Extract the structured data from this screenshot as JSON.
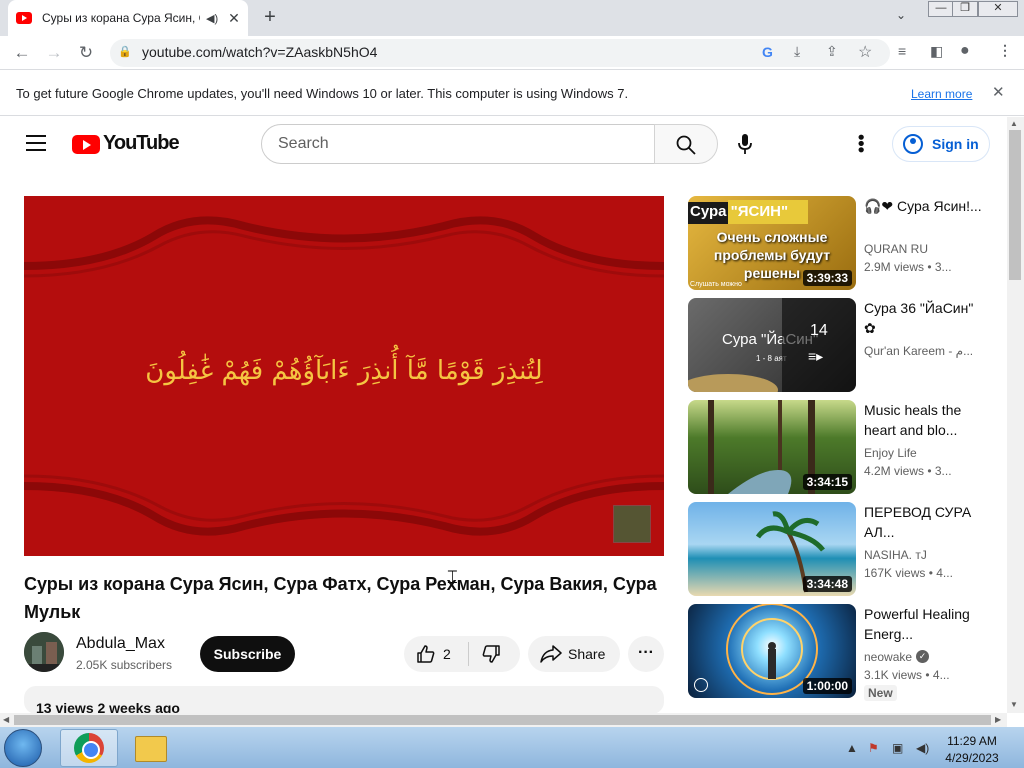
{
  "browser": {
    "tab_title": "Суры из корана Сура Ясин, Су",
    "tab_audio_icon": "speaker-icon",
    "new_tab": "+",
    "url": "youtube.com/watch?v=ZAaskbN5hO4",
    "infobar_text": "To get future Google Chrome updates, you'll need Windows 10 or later. This computer is using Windows 7.",
    "learn_more": "Learn more"
  },
  "youtube": {
    "logo_text": "YouTube",
    "search_placeholder": "Search",
    "sign_in": "Sign in",
    "arabic_caption": "لِتُنذِرَ قَوْمًا مَّآ أُنذِرَ ءَابَآؤُهُمْ فَهُمْ غَٰفِلُونَ",
    "video": {
      "title": "Суры из корана Сура Ясин, Сура Фатх, Сура Рехман, Сура Вакия, Сура Мульк",
      "channel": "Abdula_Max",
      "subscribers": "2.05K subscribers",
      "subscribe": "Subscribe",
      "likes": "2",
      "share": "Share",
      "views_date": "13 views  2 weeks ago"
    },
    "sidebar": [
      {
        "title": "🎧❤ Сура Ясин!...",
        "channel": "QURAN RU",
        "meta": "2.9M views  • 3...",
        "duration": "3:39:33",
        "thumb_text": [
          "Сура \"ЯСИН\"",
          "Очень сложные",
          "проблемы будут",
          "решены"
        ],
        "thumb_caption": "Слушать можно"
      },
      {
        "title": "Сура 36 \"ЙаСин\" ✿",
        "channel": "Qur'an Kareem - م...",
        "meta": "",
        "playlist_count": "14",
        "thumb_text": [
          "Сура \"ЙаСин\"",
          "1 - 8 аят"
        ]
      },
      {
        "title": "Music heals the heart and blo...",
        "channel": "Enjoy Life",
        "meta": "4.2M views  • 3...",
        "duration": "3:34:15"
      },
      {
        "title": "ПЕРЕВОД СУРА АЛ...",
        "channel": "NASIHA. тJ",
        "meta": "167K views  • 4...",
        "duration": "3:34:48"
      },
      {
        "title": "Powerful Healing Energ...",
        "channel": "neowake",
        "meta": "3.1K views  • 4...",
        "duration": "1:00:00",
        "badge": "New"
      }
    ]
  },
  "taskbar": {
    "time": "11:29 AM",
    "date": "4/29/2023"
  }
}
